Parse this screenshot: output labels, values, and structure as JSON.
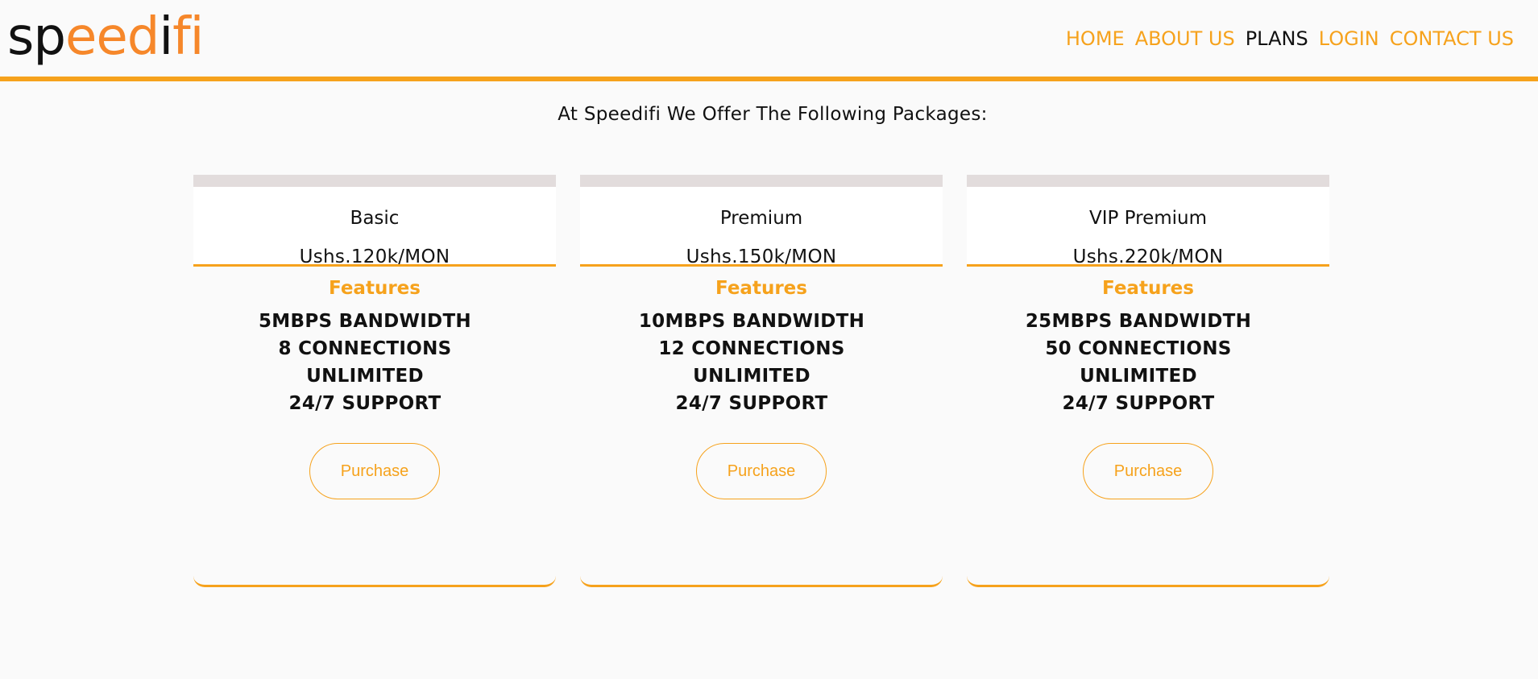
{
  "header": {
    "logo": {
      "part1": "sp",
      "part2": "eed",
      "part3": "i",
      "part4": "fi"
    },
    "nav": [
      "HOME",
      "ABOUT US",
      "PLANS",
      "LOGIN",
      "CONTACT US"
    ],
    "active_nav": "PLANS"
  },
  "intro": "At Speedifi We Offer The Following Packages:",
  "plans": [
    {
      "name": "Basic",
      "price": "Ushs.120k/MON",
      "features_title": "Features",
      "features": [
        "5MBPS BANDWIDTH",
        "8 CONNECTIONS",
        "UNLIMITED",
        "24/7 SUPPORT"
      ],
      "button": "Purchase"
    },
    {
      "name": "Premium",
      "price": "Ushs.150k/MON",
      "features_title": "Features",
      "features": [
        "10MBPS BANDWIDTH",
        "12 CONNECTIONS",
        "UNLIMITED",
        "24/7 SUPPORT"
      ],
      "button": "Purchase"
    },
    {
      "name": "VIP Premium",
      "price": "Ushs.220k/MON",
      "features_title": "Features",
      "features": [
        "25MBPS BANDWIDTH",
        "50 CONNECTIONS",
        "UNLIMITED",
        "24/7 SUPPORT"
      ],
      "button": "Purchase"
    }
  ],
  "colors": {
    "accent": "#f6a21c",
    "logo_orange": "#f6872a",
    "text": "#111111",
    "card_topbar": "#e2dcdc",
    "background": "#fafafa"
  }
}
